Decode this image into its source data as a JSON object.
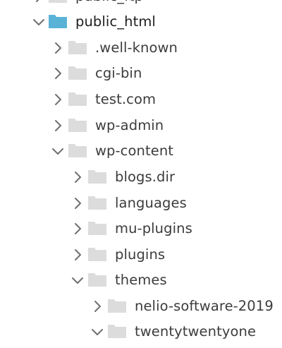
{
  "colors": {
    "folder_default": "#dcdcdc",
    "folder_selected": "#5ab3d6",
    "chevron": "#6f6f6f",
    "text": "#3c3c3c"
  },
  "tree": {
    "items": [
      {
        "label": "public_ftp",
        "expanded": false,
        "selected": false
      },
      {
        "label": "public_html",
        "expanded": true,
        "selected": true
      },
      {
        "label": ".well-known",
        "expanded": false,
        "selected": false
      },
      {
        "label": "cgi-bin",
        "expanded": false,
        "selected": false
      },
      {
        "label": "test.com",
        "expanded": false,
        "selected": false
      },
      {
        "label": "wp-admin",
        "expanded": false,
        "selected": false
      },
      {
        "label": "wp-content",
        "expanded": true,
        "selected": false
      },
      {
        "label": "blogs.dir",
        "expanded": false,
        "selected": false
      },
      {
        "label": "languages",
        "expanded": false,
        "selected": false
      },
      {
        "label": "mu-plugins",
        "expanded": false,
        "selected": false
      },
      {
        "label": "plugins",
        "expanded": false,
        "selected": false
      },
      {
        "label": "themes",
        "expanded": true,
        "selected": false
      },
      {
        "label": "nelio-software-2019",
        "expanded": false,
        "selected": false
      },
      {
        "label": "twentytwentyone",
        "expanded": true,
        "selected": false
      }
    ]
  }
}
